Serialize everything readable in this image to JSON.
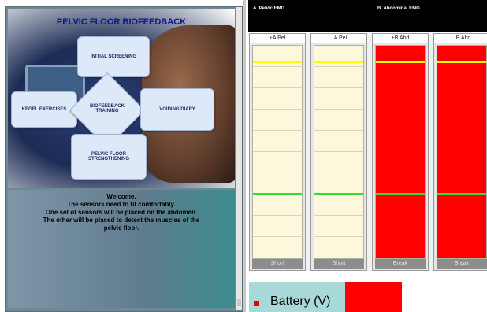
{
  "slide": {
    "title": "PELVIC FLOOR BIOFEEDBACK",
    "boxes": {
      "initial_screening": "INITIAL SCREENING",
      "kegel_exercises": "KEGEL EXERCISES",
      "biofeedback_training": "BIOFEEDBACK TRAINING",
      "voiding_diary": "VOIDING DIARY",
      "pelvic_floor_strengthening": "PELVIC FLOOR STRENGTHENING"
    }
  },
  "welcome": {
    "lines": [
      "Welcome.",
      "The sensors need to fit comfortably.",
      "One set of sensors will be placed on the abdomen.",
      "The other will be placed to detect the muscles of the",
      "pelvic floor."
    ]
  },
  "channels": [
    {
      "title": "A. Pelvic EMG"
    },
    {
      "title": "B. Abdominal EMG"
    }
  ],
  "columns": [
    {
      "header": "+A Pel",
      "footer": "Short",
      "level": 0.0,
      "yellow_line": 0.92,
      "green_line": 0.3
    },
    {
      "header": "..A Pel",
      "footer": "Short",
      "level": 0.0,
      "yellow_line": 0.92,
      "green_line": 0.3
    },
    {
      "header": "+B Abd",
      "footer": "Break",
      "level": 1.0,
      "yellow_line": 0.92,
      "green_line": 0.3
    },
    {
      "header": "..B Abd",
      "footer": "Break",
      "level": 1.0,
      "yellow_line": 0.92,
      "green_line": 0.3
    }
  ],
  "colors": {
    "bar": "#ff0000",
    "threshold_high": "#ffff00",
    "threshold_low": "#33dd33"
  },
  "battery": {
    "label": "Battery (V)",
    "level": 0.4
  }
}
